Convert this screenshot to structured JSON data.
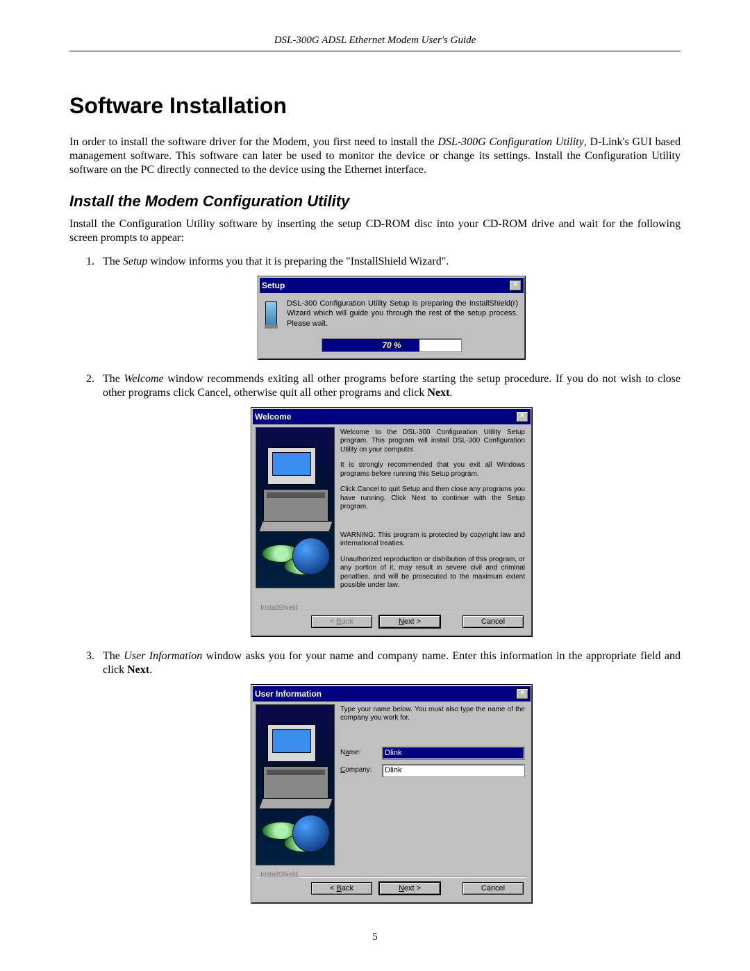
{
  "running_header": "DSL-300G ADSL Ethernet Modem User's Guide",
  "title": "Software Installation",
  "intro_before": "In order to install the software driver for the Modem, you first need to install the ",
  "intro_italic1": "DSL-300G Configuration Utility",
  "intro_after": ", D-Link's GUI based management software. This software can later be used to monitor the device or change its settings. Install the Configuration Utility software on the PC directly connected to the device using the Ethernet interface.",
  "section": "Install the Modem Configuration Utility",
  "section_intro": "Install the Configuration Utility software by inserting the setup CD-ROM disc into your CD-ROM drive and wait for the following screen prompts to appear:",
  "step1_before": "The ",
  "step1_italic": "Setup",
  "step1_after": " window informs you that it is preparing the \"InstallShield Wizard\".",
  "step2_before": "The ",
  "step2_italic": "Welcome",
  "step2_mid": " window recommends exiting all other programs before starting the setup procedure. If you do not wish to close other programs click Cancel, otherwise quit all other programs and click ",
  "step2_bold": "Next",
  "step2_end": ".",
  "step3_before": "The ",
  "step3_italic": "User Information",
  "step3_mid": " window asks you for your name and company name. Enter this information in the appropriate field and click ",
  "step3_bold": "Next",
  "step3_end": ".",
  "setup": {
    "title": "Setup",
    "msg": "DSL-300 Configuration Utility Setup is preparing the InstallShield(r) Wizard which will guide you through the rest of the setup process. Please wait.",
    "progress": "70 %"
  },
  "welcome": {
    "title": "Welcome",
    "p1": "Welcome to the DSL-300 Configuration Utility Setup program. This program will install DSL-300 Configuration Utility on your computer.",
    "p2": "It is strongly recommended that you exit all Windows programs before running this Setup program.",
    "p3": "Click Cancel to quit Setup and then close any programs you have running. Click Next to continue with the Setup program.",
    "p4": "WARNING: This program is protected by copyright law and international treaties.",
    "p5": "Unauthorized reproduction or distribution of this program, or any portion of it, may result in severe civil and criminal penalties, and will be prosecuted to the maximum extent possible under law.",
    "group": "InstallShield"
  },
  "userinfo": {
    "title": "User Information",
    "msg": "Type your name below. You must also type the name of the company you work for.",
    "name_label": "Name:",
    "name_value": "Dlink",
    "company_label": "Company:",
    "company_value": "Dlink",
    "group": "InstallShield"
  },
  "buttons": {
    "back": "< Back",
    "next": "Next >",
    "cancel": "Cancel"
  },
  "page_number": "5"
}
